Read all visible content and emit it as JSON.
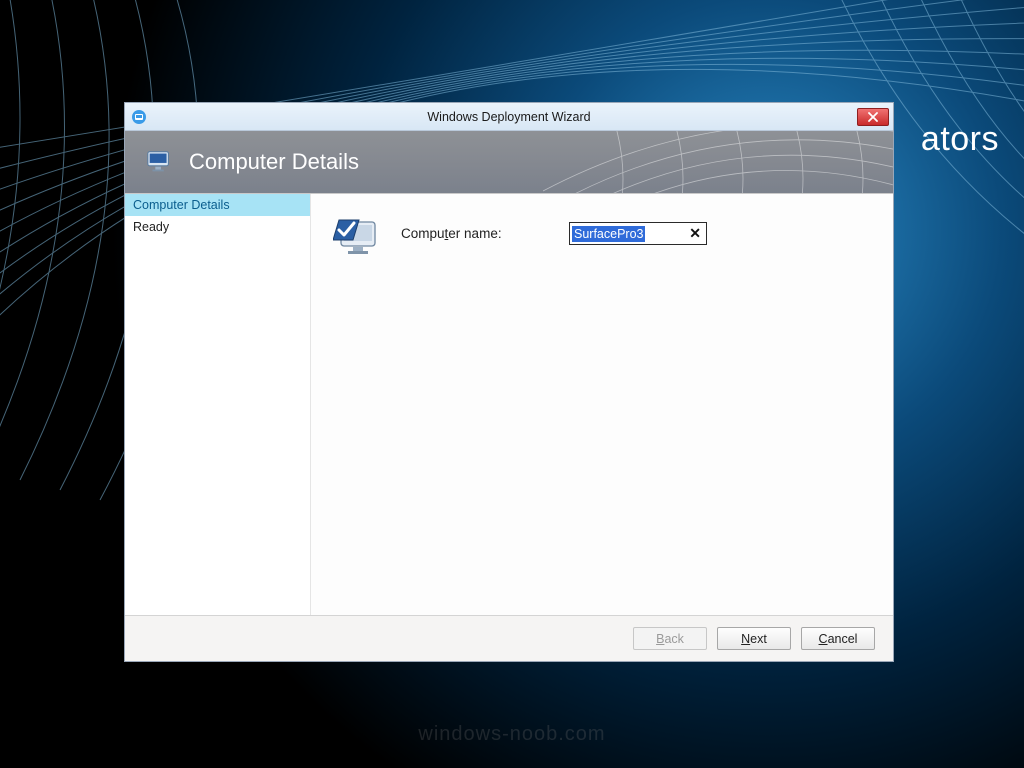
{
  "background": {
    "partial_text": "ators",
    "watermark": "windows-noob.com"
  },
  "window": {
    "title": "Windows Deployment Wizard"
  },
  "banner": {
    "title": "Computer Details"
  },
  "sidebar": {
    "items": [
      {
        "label": "Computer Details",
        "active": true
      },
      {
        "label": "Ready",
        "active": false
      }
    ]
  },
  "form": {
    "computer_name_label_pre": "Compu",
    "computer_name_label_u": "t",
    "computer_name_label_post": "er name:",
    "computer_name_value": "SurfacePro3"
  },
  "footer": {
    "back_pre": "",
    "back_u": "B",
    "back_post": "ack",
    "next_pre": "",
    "next_u": "N",
    "next_post": "ext",
    "cancel_pre": "",
    "cancel_u": "C",
    "cancel_post": "ancel"
  }
}
